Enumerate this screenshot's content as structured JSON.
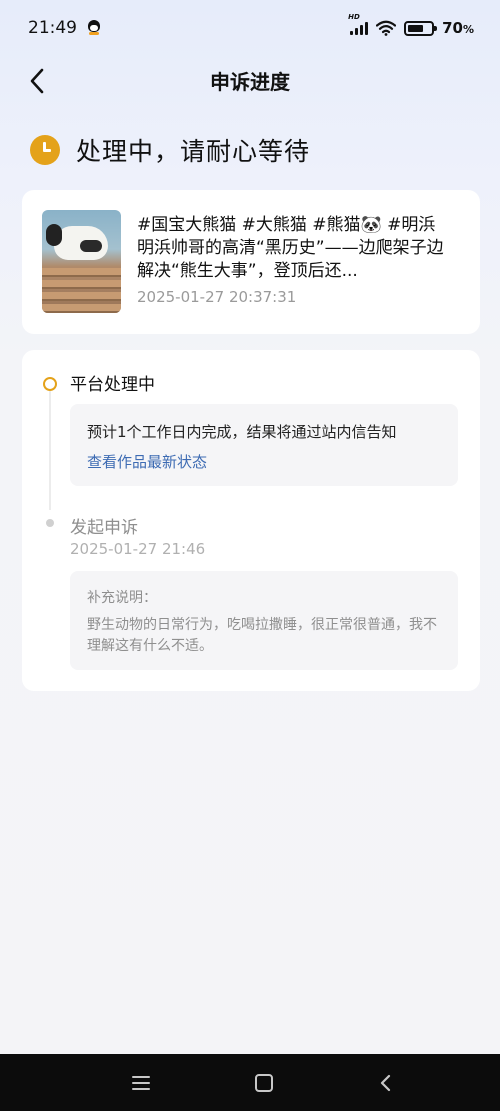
{
  "status_bar": {
    "time": "21:49",
    "network_tag": "HD",
    "battery_value": "70",
    "battery_unit": "%",
    "icons": [
      "qq-icon",
      "signal-icon",
      "wifi-icon",
      "battery-icon"
    ]
  },
  "header": {
    "title": "申诉进度",
    "back_icon": "chevron-left-icon"
  },
  "status": {
    "icon": "clock-icon",
    "text": "处理中，请耐心等待",
    "accent_color": "#e4a21a"
  },
  "video": {
    "title": "#国宝大熊猫 #大熊猫 #熊猫🐼 #明浜 明浜帅哥的高清“黑历史”——边爬架子边解决“熊生大事”，登顶后还...",
    "date": "2025-01-27 20:37:31"
  },
  "timeline": {
    "steps": [
      {
        "title": "平台处理中",
        "description": "预计1个工作日内完成，结果将通过站内信告知",
        "link": "查看作品最新状态"
      },
      {
        "title": "发起申诉",
        "date": "2025-01-27 21:46",
        "note_label": "补充说明：",
        "note_text": "野生动物的日常行为，吃喝拉撒睡，很正常很普通，我不理解这有什么不适。"
      }
    ],
    "link_color": "#3d6bb3"
  },
  "nav_bar": {
    "icons": [
      "menu-icon",
      "home-icon",
      "back-icon"
    ]
  }
}
